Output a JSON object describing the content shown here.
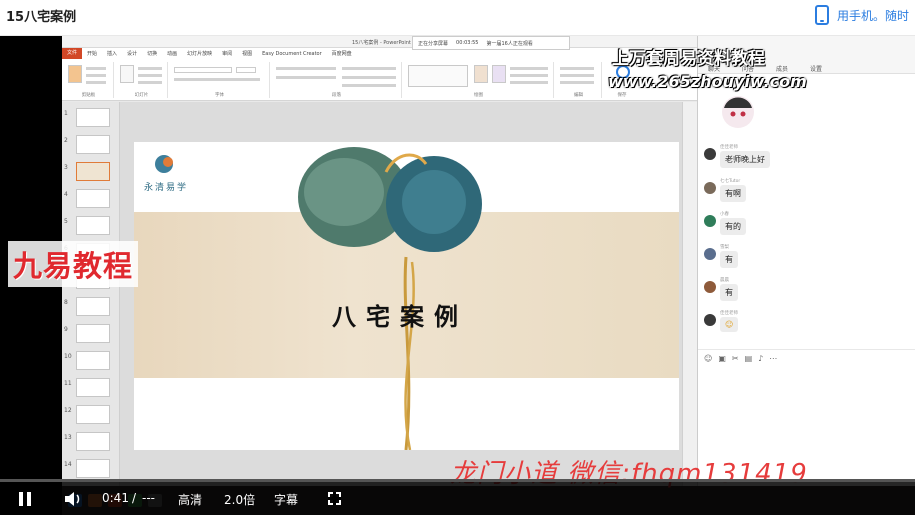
{
  "page": {
    "title": "15八宅案例",
    "phone_link": "用手机。随时"
  },
  "ppt": {
    "window_title": "15八宅案例 - PowerPoint",
    "tabs": [
      "文件",
      "开始",
      "插入",
      "设计",
      "切换",
      "动画",
      "幻灯片放映",
      "审阅",
      "视图",
      "Easy Document Creator",
      "百度网盘"
    ],
    "ribbon_groups": [
      "剪贴板",
      "幻灯片",
      "字体",
      "段落",
      "绘图",
      "编辑",
      "保存"
    ],
    "recorder_labels": [
      "正在分享屏幕",
      "00:03:55",
      "第一届16人正在观看"
    ],
    "thumb_numbers": [
      "1",
      "2",
      "3",
      "4",
      "5",
      "6",
      "7",
      "8",
      "9",
      "10",
      "11",
      "12",
      "13",
      "14"
    ],
    "slide": {
      "logo_text": "永清易学",
      "title": "八宅案例"
    }
  },
  "chat": {
    "tabs": [
      "聊天",
      "问答",
      "成员",
      "设置"
    ],
    "messages": [
      {
        "name": "佳佳老师",
        "text": "老师晚上好"
      },
      {
        "name": "七七Tutor",
        "text": "有啊"
      },
      {
        "name": "小春",
        "text": "有的"
      },
      {
        "name": "雪梨",
        "text": "有"
      },
      {
        "name": "晨晨",
        "text": "有"
      },
      {
        "name": "佳佳老师",
        "text": "☺"
      }
    ]
  },
  "watermarks": {
    "top": "上万套周易资料教程",
    "url": "www.265zhouyiw.com",
    "left": "九易教程",
    "bottom": "龙门小道 微信:fhqm131419"
  },
  "player": {
    "time_current": "0:41",
    "time_separator": "/",
    "time_total": "---",
    "quality": "高清",
    "speed": "2.0倍",
    "subtitle": "字幕",
    "progress": 0.0
  },
  "colors": {
    "accent": "#2b7de0",
    "ppt_file_tab": "#d24726",
    "watermark_red": "#e0292f"
  }
}
